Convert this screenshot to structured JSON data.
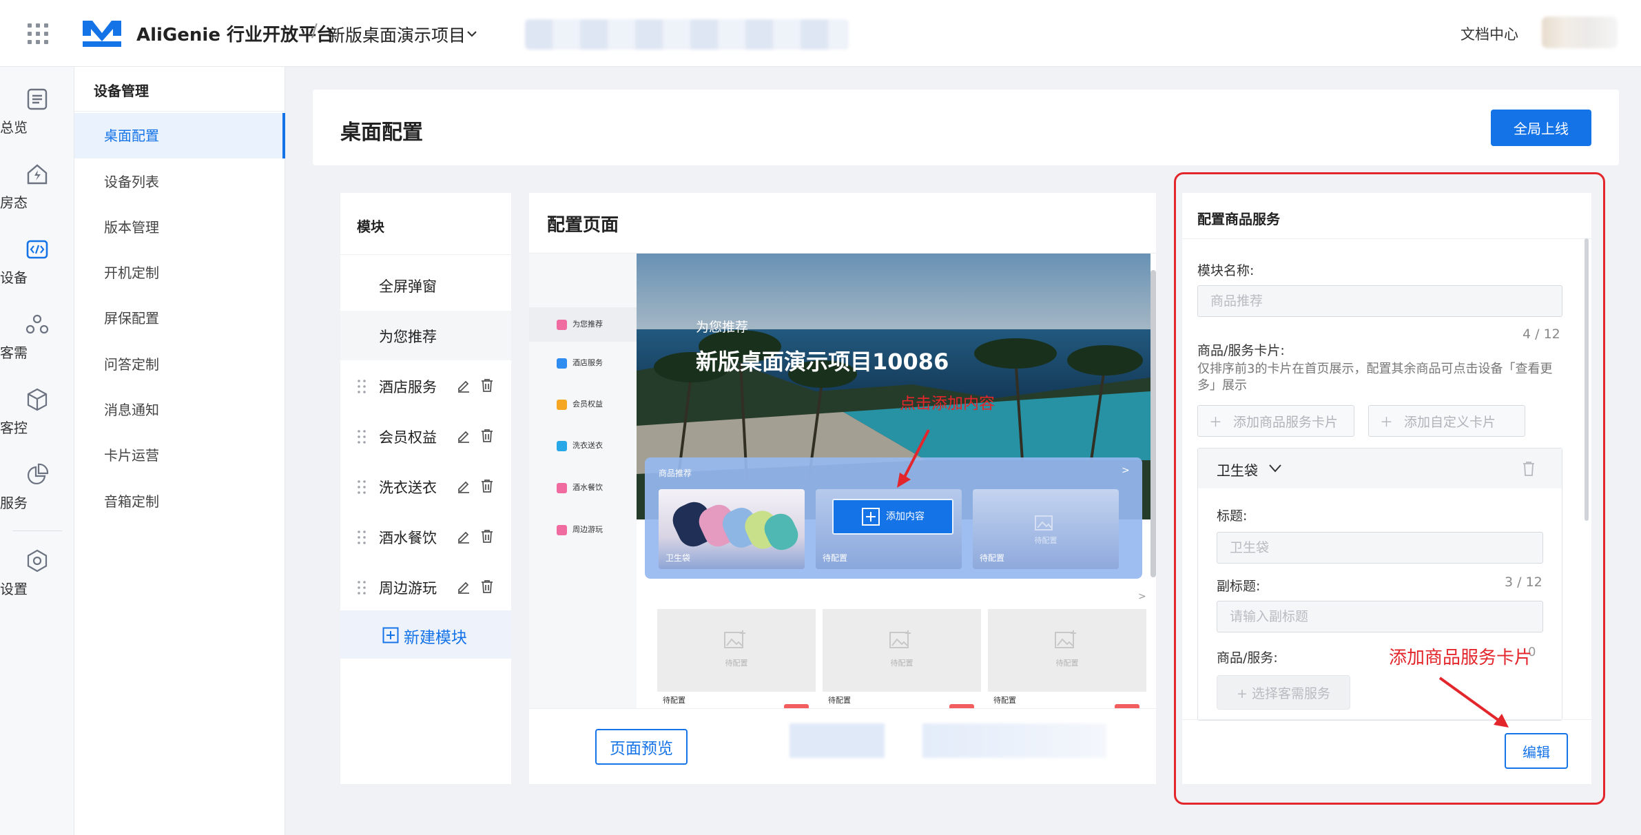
{
  "header": {
    "brand": "AliGenie 行业开放平台",
    "separator": "/",
    "project": "新版桌面演示项目",
    "doc_center": "文档中心"
  },
  "rail": {
    "items": [
      {
        "label": "总览",
        "icon": "list-icon"
      },
      {
        "label": "房态",
        "icon": "house-icon"
      },
      {
        "label": "设备",
        "icon": "code-icon",
        "active": true
      },
      {
        "label": "客需",
        "icon": "people-icon"
      },
      {
        "label": "客控",
        "icon": "cube-icon"
      },
      {
        "label": "服务",
        "icon": "pie-icon"
      },
      {
        "label": "设置",
        "icon": "gear-icon"
      }
    ]
  },
  "submenu": {
    "title": "设备管理",
    "items": [
      "桌面配置",
      "设备列表",
      "版本管理",
      "开机定制",
      "屏保配置",
      "问答定制",
      "消息通知",
      "卡片运营",
      "音箱定制"
    ],
    "active_index": 0
  },
  "page": {
    "title": "桌面配置",
    "publish_button": "全局上线"
  },
  "modules": {
    "title": "模块",
    "items": [
      "全屏弹窗",
      "为您推荐",
      "酒店服务",
      "会员权益",
      "洗衣送衣",
      "酒水餐饮",
      "周边游玩"
    ],
    "new_module": "新建模块"
  },
  "config": {
    "title": "配置页面",
    "preview_nav": [
      "为您推荐",
      "酒店服务",
      "会员权益",
      "洗衣送衣",
      "酒水餐饮",
      "周边游玩"
    ],
    "preview_nav_colors": [
      "#f06ba0",
      "#2f8cf0",
      "#f5a623",
      "#29a8e8",
      "#f06ba0",
      "#f06ba0"
    ],
    "hero_subtitle": "为您推荐",
    "hero_title": "新版桌面演示项目10086",
    "annotation": "点击添加内容",
    "card_title": "商品推荐",
    "card_more": ">",
    "slots": [
      "卫生袋",
      "待配置",
      "待配置"
    ],
    "slot_placeholder": "待配置",
    "add_content": "添加内容",
    "row2_more": ">",
    "grid_placeholder": "待配置",
    "grid_captions": [
      "待配置",
      "待配置",
      "待配置"
    ],
    "preview_button": "页面预览"
  },
  "right_panel": {
    "title": "配置商品服务",
    "module_name_label": "模块名称:",
    "module_name_placeholder": "商品推荐",
    "module_name_count": "4 / 12",
    "cards_label": "商品/服务卡片:",
    "cards_desc": "仅排序前3的卡片在首页展示，配置其余商品可点击设备「查看更多」展示",
    "add_goods_card": "添加商品服务卡片",
    "add_custom_card": "添加自定义卡片",
    "goods_card": {
      "name": "卫生袋",
      "title_label": "标题:",
      "title_placeholder": "卫生袋",
      "subtitle_label": "副标题:",
      "subtitle_count": "3 / 12",
      "subtitle_placeholder": "请输入副标题",
      "goods_label": "商品/服务:",
      "goods_count": "0",
      "select_service": "+ 选择客需服务"
    },
    "annotation": "添加商品服务卡片",
    "edit_button": "编辑"
  },
  "colors": {
    "primary": "#1573e8",
    "annotation": "#e3262b"
  }
}
